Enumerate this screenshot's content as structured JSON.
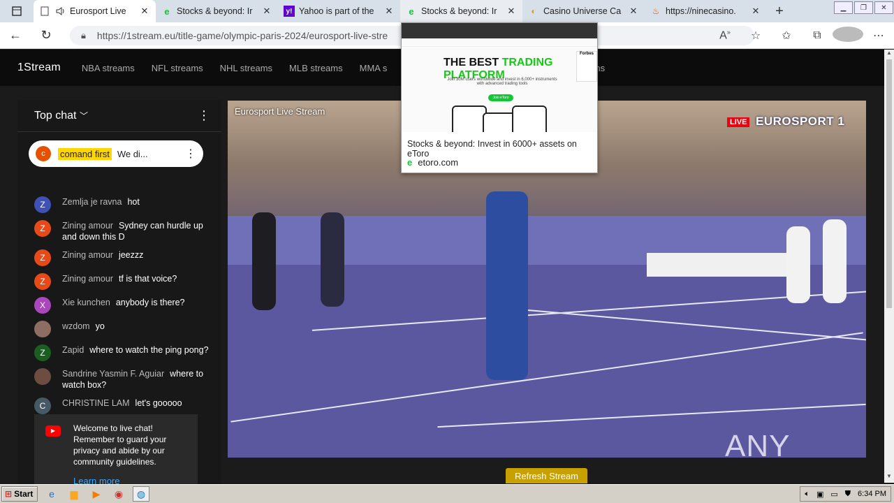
{
  "browser": {
    "tabs": [
      {
        "title": "Eurosport Live",
        "favicon": "document-icon",
        "active": true
      },
      {
        "title": "Stocks & beyond: Ir",
        "favicon": "etoro-icon",
        "active": false
      },
      {
        "title": "Yahoo is part of the",
        "favicon": "yahoo-icon",
        "active": false
      },
      {
        "title": "Stocks & beyond: Ir",
        "favicon": "etoro-icon",
        "active": false
      },
      {
        "title": "Casino Universe Ca",
        "favicon": "casino-icon",
        "active": false
      },
      {
        "title": "https://ninecasino.",
        "favicon": "fire-icon",
        "active": false
      }
    ],
    "url": "https://1stream.eu/title-game/olympic-paris-2024/eurosport-live-stre"
  },
  "site": {
    "logo": "1Stream",
    "nav": [
      "NBA streams",
      "NFL streams",
      "NHL streams",
      "MLB streams",
      "MMA s",
      "eams"
    ]
  },
  "chat": {
    "header": "Top chat",
    "pinned": {
      "initial": "c",
      "name": "comand first",
      "message": "We di..."
    },
    "messages": [
      {
        "initial": "Z",
        "color": "#3f51b5",
        "name": "Zemlja je ravna",
        "text": "hot"
      },
      {
        "initial": "Z",
        "color": "#e64a19",
        "name": "Zining amour",
        "text": "Sydney can hurdle up and down this D"
      },
      {
        "initial": "Z",
        "color": "#e64a19",
        "name": "Zining amour",
        "text": "jeezzz"
      },
      {
        "initial": "Z",
        "color": "#e64a19",
        "name": "Zining amour",
        "text": "tf is that voice?"
      },
      {
        "initial": "X",
        "color": "#ab47bc",
        "name": "Xie kunchen",
        "text": "anybody is there?"
      },
      {
        "initial": "",
        "color": "#8d6e63",
        "name": "wzdom",
        "text": "yo"
      },
      {
        "initial": "Z",
        "color": "#1b5e20",
        "name": "Zapid",
        "text": "where to watch the ping pong?"
      },
      {
        "initial": "",
        "color": "#6d4c41",
        "name": "Sandrine Yasmin F. Aguiar",
        "text": "where to watch box?"
      },
      {
        "initial": "C",
        "color": "#455a64",
        "name": "CHRISTINE LAM",
        "text": "let's gooooo"
      }
    ],
    "welcome": {
      "text": "Welcome to live chat! Remember to guard your privacy and abide by our community guidelines.",
      "link": "Learn more"
    }
  },
  "player": {
    "title": "Eurosport Live Stream",
    "live": "LIVE",
    "channel": "EUROSPORT 1",
    "watermark": "ANY RUN"
  },
  "refresh_button": "Refresh Stream",
  "tab_preview": {
    "headline_a": "THE BEST",
    "headline_b": "TRADING PLATFORM",
    "sub": "Join 30M users worldwide and invest in 6,000+ instruments with advanced trading tools",
    "cta": "Join eToro",
    "badge": "Forbes",
    "title": "Stocks & beyond: Invest in 6000+ assets on eToro",
    "domain": "etoro.com"
  },
  "taskbar": {
    "start": "Start",
    "time": "6:34 PM"
  }
}
